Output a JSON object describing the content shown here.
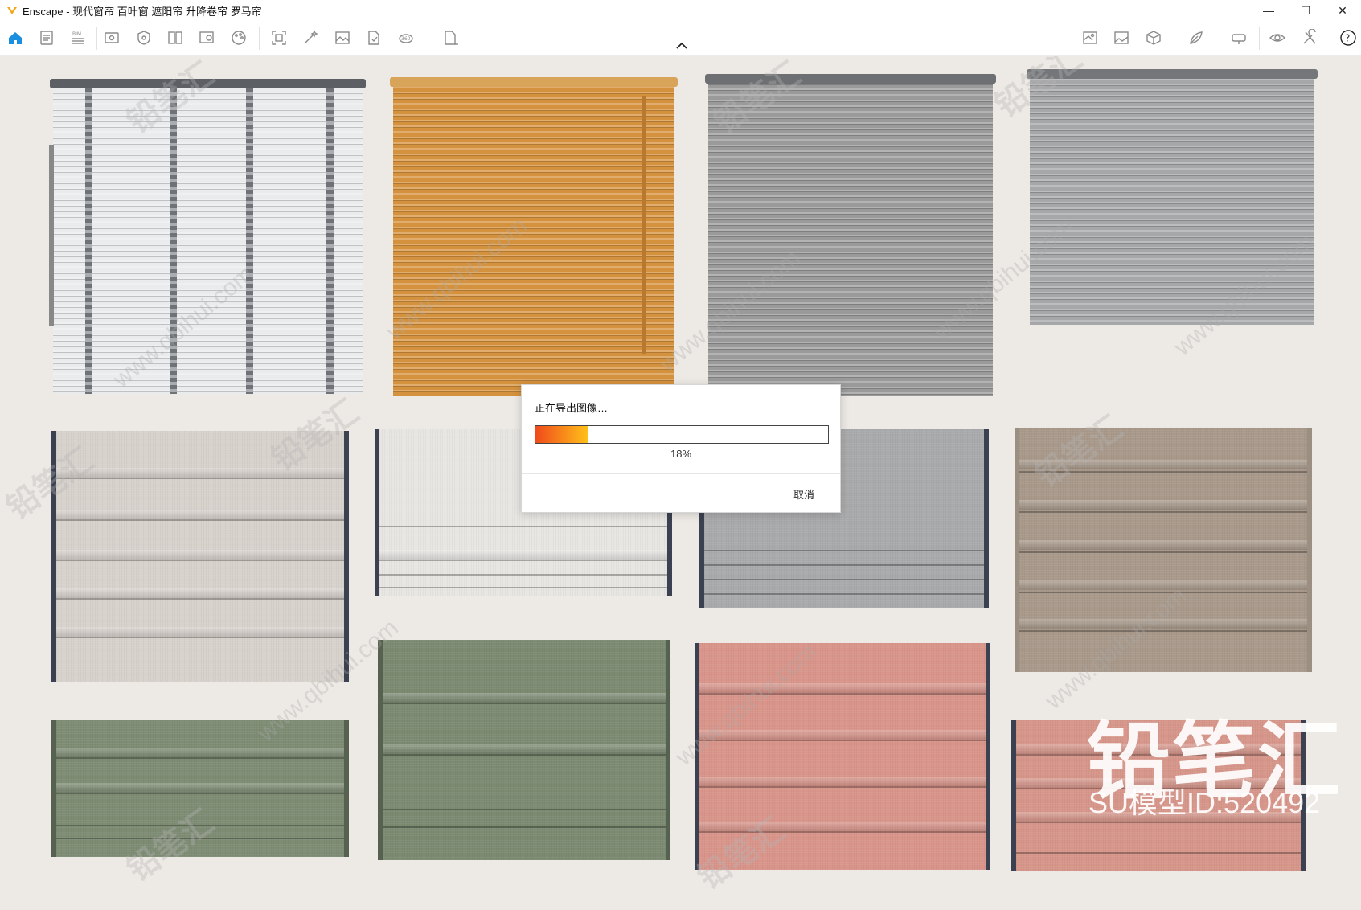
{
  "window": {
    "title": "Enscape - 现代窗帘 百叶窗 遮阳帘 升降卷帘 罗马帘",
    "controls": {
      "minimize": "—",
      "maximize": "☐",
      "close": "✕"
    }
  },
  "toolbar": {
    "tools": [
      {
        "name": "home-icon"
      },
      {
        "name": "document-icon"
      },
      {
        "name": "bim-icon",
        "label": "BIM"
      },
      {
        "name": "view-icon"
      },
      {
        "name": "asset-icon"
      },
      {
        "name": "library-icon"
      },
      {
        "name": "settings-icon"
      },
      {
        "name": "palette-icon"
      },
      {
        "name": "screenshot-icon"
      },
      {
        "name": "magic-icon"
      },
      {
        "name": "image-icon"
      },
      {
        "name": "export-icon"
      },
      {
        "name": "panorama-icon",
        "label": "360"
      },
      {
        "name": "batch-icon"
      },
      {
        "name": "map-icon"
      },
      {
        "name": "gallery-icon"
      },
      {
        "name": "cube-icon"
      },
      {
        "name": "feather-icon"
      },
      {
        "name": "vr-icon"
      },
      {
        "name": "eye-icon"
      },
      {
        "name": "tools-icon"
      },
      {
        "name": "help-icon",
        "label": "?"
      }
    ]
  },
  "watermark": {
    "brand": "铅笔汇",
    "url": "www.qbihui.com",
    "model_id": "SU模型ID:520492"
  },
  "dialog": {
    "title": "正在导出图像…",
    "progress_percent": 18,
    "progress_label": "18%",
    "cancel_label": "取消"
  },
  "colors": {
    "progress_start": "#f04a1b",
    "progress_end": "#ffc21a",
    "accent": "#1a8fe0"
  }
}
